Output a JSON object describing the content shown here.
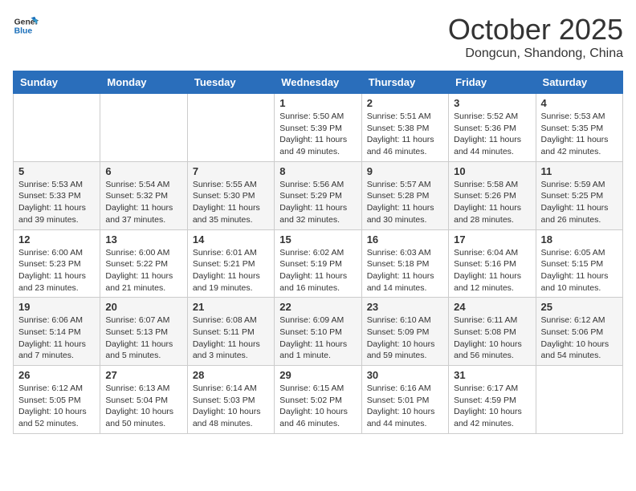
{
  "header": {
    "logo_line1": "General",
    "logo_line2": "Blue",
    "month_title": "October 2025",
    "location": "Dongcun, Shandong, China"
  },
  "weekdays": [
    "Sunday",
    "Monday",
    "Tuesday",
    "Wednesday",
    "Thursday",
    "Friday",
    "Saturday"
  ],
  "weeks": [
    [
      {
        "day": "",
        "info": ""
      },
      {
        "day": "",
        "info": ""
      },
      {
        "day": "",
        "info": ""
      },
      {
        "day": "1",
        "info": "Sunrise: 5:50 AM\nSunset: 5:39 PM\nDaylight: 11 hours\nand 49 minutes."
      },
      {
        "day": "2",
        "info": "Sunrise: 5:51 AM\nSunset: 5:38 PM\nDaylight: 11 hours\nand 46 minutes."
      },
      {
        "day": "3",
        "info": "Sunrise: 5:52 AM\nSunset: 5:36 PM\nDaylight: 11 hours\nand 44 minutes."
      },
      {
        "day": "4",
        "info": "Sunrise: 5:53 AM\nSunset: 5:35 PM\nDaylight: 11 hours\nand 42 minutes."
      }
    ],
    [
      {
        "day": "5",
        "info": "Sunrise: 5:53 AM\nSunset: 5:33 PM\nDaylight: 11 hours\nand 39 minutes."
      },
      {
        "day": "6",
        "info": "Sunrise: 5:54 AM\nSunset: 5:32 PM\nDaylight: 11 hours\nand 37 minutes."
      },
      {
        "day": "7",
        "info": "Sunrise: 5:55 AM\nSunset: 5:30 PM\nDaylight: 11 hours\nand 35 minutes."
      },
      {
        "day": "8",
        "info": "Sunrise: 5:56 AM\nSunset: 5:29 PM\nDaylight: 11 hours\nand 32 minutes."
      },
      {
        "day": "9",
        "info": "Sunrise: 5:57 AM\nSunset: 5:28 PM\nDaylight: 11 hours\nand 30 minutes."
      },
      {
        "day": "10",
        "info": "Sunrise: 5:58 AM\nSunset: 5:26 PM\nDaylight: 11 hours\nand 28 minutes."
      },
      {
        "day": "11",
        "info": "Sunrise: 5:59 AM\nSunset: 5:25 PM\nDaylight: 11 hours\nand 26 minutes."
      }
    ],
    [
      {
        "day": "12",
        "info": "Sunrise: 6:00 AM\nSunset: 5:23 PM\nDaylight: 11 hours\nand 23 minutes."
      },
      {
        "day": "13",
        "info": "Sunrise: 6:00 AM\nSunset: 5:22 PM\nDaylight: 11 hours\nand 21 minutes."
      },
      {
        "day": "14",
        "info": "Sunrise: 6:01 AM\nSunset: 5:21 PM\nDaylight: 11 hours\nand 19 minutes."
      },
      {
        "day": "15",
        "info": "Sunrise: 6:02 AM\nSunset: 5:19 PM\nDaylight: 11 hours\nand 16 minutes."
      },
      {
        "day": "16",
        "info": "Sunrise: 6:03 AM\nSunset: 5:18 PM\nDaylight: 11 hours\nand 14 minutes."
      },
      {
        "day": "17",
        "info": "Sunrise: 6:04 AM\nSunset: 5:16 PM\nDaylight: 11 hours\nand 12 minutes."
      },
      {
        "day": "18",
        "info": "Sunrise: 6:05 AM\nSunset: 5:15 PM\nDaylight: 11 hours\nand 10 minutes."
      }
    ],
    [
      {
        "day": "19",
        "info": "Sunrise: 6:06 AM\nSunset: 5:14 PM\nDaylight: 11 hours\nand 7 minutes."
      },
      {
        "day": "20",
        "info": "Sunrise: 6:07 AM\nSunset: 5:13 PM\nDaylight: 11 hours\nand 5 minutes."
      },
      {
        "day": "21",
        "info": "Sunrise: 6:08 AM\nSunset: 5:11 PM\nDaylight: 11 hours\nand 3 minutes."
      },
      {
        "day": "22",
        "info": "Sunrise: 6:09 AM\nSunset: 5:10 PM\nDaylight: 11 hours\nand 1 minute."
      },
      {
        "day": "23",
        "info": "Sunrise: 6:10 AM\nSunset: 5:09 PM\nDaylight: 10 hours\nand 59 minutes."
      },
      {
        "day": "24",
        "info": "Sunrise: 6:11 AM\nSunset: 5:08 PM\nDaylight: 10 hours\nand 56 minutes."
      },
      {
        "day": "25",
        "info": "Sunrise: 6:12 AM\nSunset: 5:06 PM\nDaylight: 10 hours\nand 54 minutes."
      }
    ],
    [
      {
        "day": "26",
        "info": "Sunrise: 6:12 AM\nSunset: 5:05 PM\nDaylight: 10 hours\nand 52 minutes."
      },
      {
        "day": "27",
        "info": "Sunrise: 6:13 AM\nSunset: 5:04 PM\nDaylight: 10 hours\nand 50 minutes."
      },
      {
        "day": "28",
        "info": "Sunrise: 6:14 AM\nSunset: 5:03 PM\nDaylight: 10 hours\nand 48 minutes."
      },
      {
        "day": "29",
        "info": "Sunrise: 6:15 AM\nSunset: 5:02 PM\nDaylight: 10 hours\nand 46 minutes."
      },
      {
        "day": "30",
        "info": "Sunrise: 6:16 AM\nSunset: 5:01 PM\nDaylight: 10 hours\nand 44 minutes."
      },
      {
        "day": "31",
        "info": "Sunrise: 6:17 AM\nSunset: 4:59 PM\nDaylight: 10 hours\nand 42 minutes."
      },
      {
        "day": "",
        "info": ""
      }
    ]
  ]
}
